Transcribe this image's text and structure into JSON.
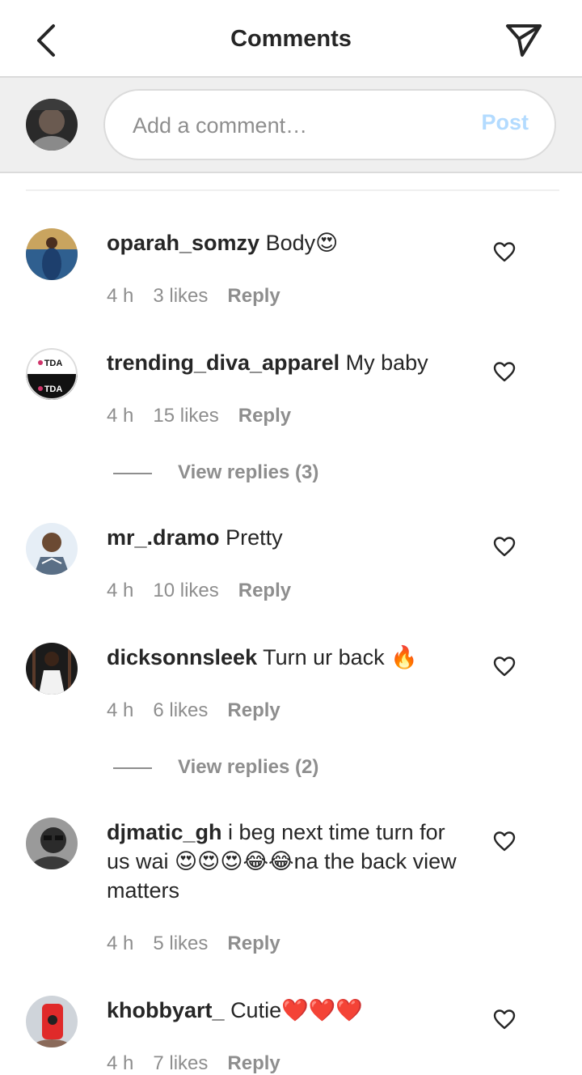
{
  "header": {
    "title": "Comments"
  },
  "composer": {
    "placeholder": "Add a comment…",
    "post_label": "Post"
  },
  "comments": [
    {
      "username": "oparah_somzy",
      "text": "Body😍",
      "time": "4 h",
      "likes": "3 likes",
      "reply": "Reply"
    },
    {
      "username": "trending_diva_apparel",
      "text": "My baby",
      "time": "4 h",
      "likes": "15 likes",
      "reply": "Reply",
      "view_replies": "View replies (3)"
    },
    {
      "username": "mr_.dramo",
      "text": "Pretty",
      "time": "4 h",
      "likes": "10 likes",
      "reply": "Reply"
    },
    {
      "username": "dicksonnsleek",
      "text": "Turn ur back 🔥",
      "time": "4 h",
      "likes": "6 likes",
      "reply": "Reply",
      "view_replies": "View replies (2)"
    },
    {
      "username": "djmatic_gh",
      "text": "i beg next time turn for us wai 😍😍😍😂😂na the back view matters",
      "time": "4 h",
      "likes": "5 likes",
      "reply": "Reply"
    },
    {
      "username": "khobbyart_",
      "text": "Cutie❤️❤️❤️",
      "time": "4 h",
      "likes": "7 likes",
      "reply": "Reply"
    }
  ],
  "avatar_logo_text": "TDA",
  "icons": {
    "back": "chevron-left-icon",
    "send": "paper-plane-icon",
    "like": "heart-outline-icon"
  },
  "colors": {
    "post_disabled": "#b3dbff",
    "muted": "#8e8e8e",
    "text": "#262626"
  }
}
